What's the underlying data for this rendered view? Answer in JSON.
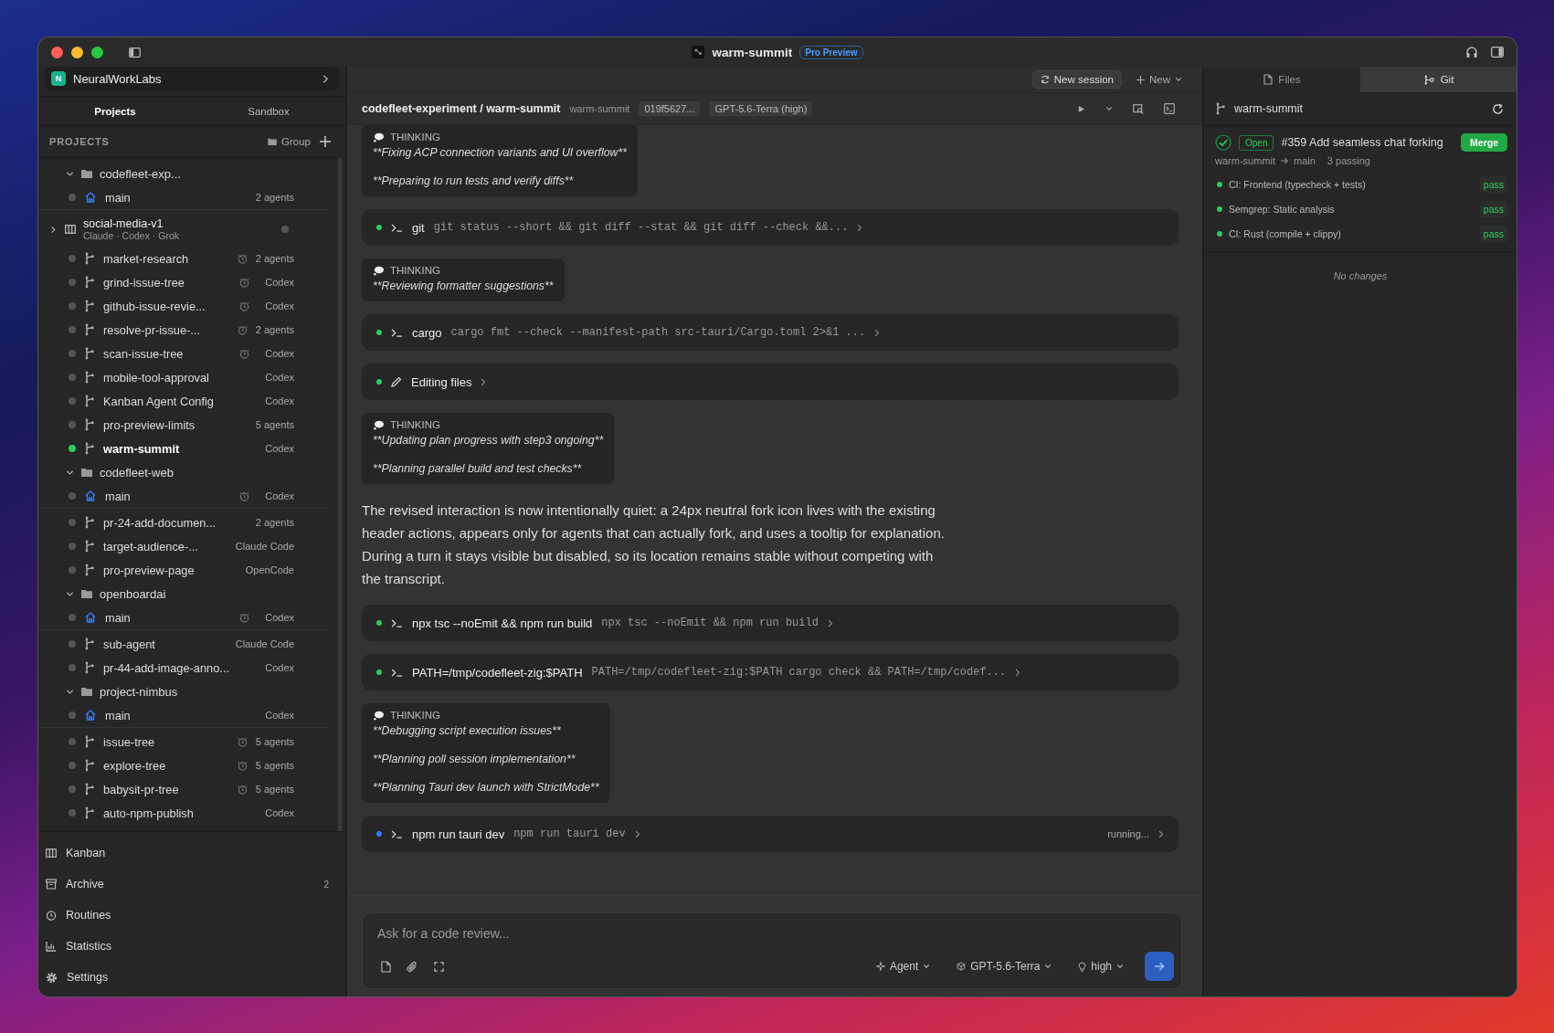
{
  "window": {
    "title": "warm-summit",
    "badge": "Pro Preview"
  },
  "workspace": {
    "initial": "N",
    "name": "NeuralWorkLabs"
  },
  "sidebar_tabs": [
    {
      "label": "Projects",
      "selected": true
    },
    {
      "label": "Sandbox",
      "selected": false
    }
  ],
  "projects_header": {
    "label": "PROJECTS",
    "group_button": "Group"
  },
  "projects": [
    {
      "name": "codefleet-exp...",
      "expanded": true,
      "children": [
        {
          "kind": "main",
          "name": "main",
          "meta": "2 agents",
          "scheduled": false,
          "active": false
        },
        {
          "kind": "board",
          "name": "social-media-v1",
          "subtitle": "Claude · Codex · Grok",
          "expanded": false,
          "active": false
        },
        {
          "kind": "branch",
          "name": "market-research",
          "meta": "2 agents",
          "scheduled": true,
          "active": false
        },
        {
          "kind": "branch",
          "name": "grind-issue-tree",
          "meta": "Codex",
          "scheduled": true,
          "active": false
        },
        {
          "kind": "branch",
          "name": "github-issue-revie...",
          "meta": "Codex",
          "scheduled": true,
          "active": false
        },
        {
          "kind": "branch",
          "name": "resolve-pr-issue-...",
          "meta": "2 agents",
          "scheduled": true,
          "active": false
        },
        {
          "kind": "branch",
          "name": "scan-issue-tree",
          "meta": "Codex",
          "scheduled": true,
          "active": false
        },
        {
          "kind": "branch",
          "name": "mobile-tool-approval",
          "meta": "Codex",
          "scheduled": false,
          "active": false
        },
        {
          "kind": "branch",
          "name": "Kanban Agent Config",
          "meta": "Codex",
          "scheduled": false,
          "active": false
        },
        {
          "kind": "branch",
          "name": "pro-preview-limits",
          "meta": "5 agents",
          "scheduled": false,
          "active": false
        },
        {
          "kind": "branch",
          "name": "warm-summit",
          "meta": "Codex",
          "scheduled": false,
          "active": true
        }
      ]
    },
    {
      "name": "codefleet-web",
      "expanded": true,
      "children": [
        {
          "kind": "main",
          "name": "main",
          "meta": "Codex",
          "scheduled": true,
          "active": false
        },
        {
          "kind": "branch",
          "name": "pr-24-add-documen...",
          "meta": "2 agents",
          "scheduled": false,
          "active": false
        },
        {
          "kind": "branch",
          "name": "target-audience-...",
          "meta": "Claude Code",
          "scheduled": false,
          "active": false
        },
        {
          "kind": "branch",
          "name": "pro-preview-page",
          "meta": "OpenCode",
          "scheduled": false,
          "active": false
        }
      ]
    },
    {
      "name": "openboardai",
      "expanded": true,
      "children": [
        {
          "kind": "main",
          "name": "main",
          "meta": "Codex",
          "scheduled": true,
          "active": false
        },
        {
          "kind": "branch",
          "name": "sub-agent",
          "meta": "Claude Code",
          "scheduled": false,
          "active": false
        },
        {
          "kind": "branch",
          "name": "pr-44-add-image-anno...",
          "meta": "Codex",
          "scheduled": false,
          "active": false
        }
      ]
    },
    {
      "name": "project-nimbus",
      "expanded": true,
      "children": [
        {
          "kind": "main",
          "name": "main",
          "meta": "Codex",
          "scheduled": false,
          "active": false
        },
        {
          "kind": "branch",
          "name": "issue-tree",
          "meta": "5 agents",
          "scheduled": true,
          "active": false
        },
        {
          "kind": "branch",
          "name": "explore-tree",
          "meta": "5 agents",
          "scheduled": true,
          "active": false
        },
        {
          "kind": "branch",
          "name": "babysit-pr-tree",
          "meta": "5 agents",
          "scheduled": true,
          "active": false
        },
        {
          "kind": "branch",
          "name": "auto-npm-publish",
          "meta": "Codex",
          "scheduled": false,
          "active": false
        }
      ]
    }
  ],
  "nav": [
    {
      "kind": "kanban",
      "label": "Kanban"
    },
    {
      "kind": "archive",
      "label": "Archive",
      "count": "2"
    },
    {
      "kind": "routines",
      "label": "Routines"
    },
    {
      "kind": "statistics",
      "label": "Statistics"
    },
    {
      "kind": "settings",
      "label": "Settings"
    }
  ],
  "toolbar": {
    "new_session": "New session",
    "new": "New"
  },
  "session_header": {
    "path": "codefleet-experiment / warm-summit",
    "branch": "warm-summit",
    "session_id": "019f5627...",
    "model": "GPT-5.6-Terra (high)"
  },
  "transcript": [
    {
      "kind": "thinking",
      "label": "THINKING",
      "lines": [
        "**Fixing ACP connection variants and UI overflow**",
        "**Preparing to run tests and verify diffs**"
      ]
    },
    {
      "kind": "command",
      "running": false,
      "name": "git",
      "detail": "git status --short && git diff --stat && git diff --check &&..."
    },
    {
      "kind": "thinking",
      "label": "THINKING",
      "lines": [
        "**Reviewing formatter suggestions**"
      ]
    },
    {
      "kind": "command",
      "running": false,
      "name": "cargo",
      "detail": "cargo fmt --check --manifest-path src-tauri/Cargo.toml 2>&1 ..."
    },
    {
      "kind": "edit",
      "running": false,
      "name": "Editing files"
    },
    {
      "kind": "thinking",
      "label": "THINKING",
      "lines": [
        "**Updating plan progress with step3 ongoing**",
        "**Planning parallel build and test checks**"
      ]
    },
    {
      "kind": "message",
      "text": "The revised interaction is now intentionally quiet: a 24px neutral fork icon lives with the existing header actions, appears only for agents that can actually fork, and uses a tooltip for explanation. During a turn it stays visible but disabled, so its location remains stable without competing with the transcript."
    },
    {
      "kind": "command",
      "running": false,
      "name": "npx tsc --noEmit && npm run build",
      "detail": "npx tsc --noEmit && npm run build"
    },
    {
      "kind": "command",
      "running": false,
      "name": "PATH=/tmp/codefleet-zig:$PATH",
      "detail": "PATH=/tmp/codefleet-zig:$PATH cargo check && PATH=/tmp/codef..."
    },
    {
      "kind": "thinking",
      "label": "THINKING",
      "lines": [
        "**Debugging script execution issues**",
        "**Planning poll session implementation**",
        "**Planning Tauri dev launch with StrictMode**"
      ]
    },
    {
      "kind": "command",
      "running": true,
      "name": "npm run tauri dev",
      "detail": "npm run tauri dev",
      "trailing": "running..."
    }
  ],
  "composer": {
    "placeholder": "Ask for a code review...",
    "mode": "Agent",
    "model": "GPT-5.6-Terra",
    "effort": "high"
  },
  "panel_tabs": [
    {
      "label": "Files",
      "selected": false
    },
    {
      "label": "Git",
      "selected": true
    }
  ],
  "git": {
    "branch": "warm-summit",
    "pr": {
      "status": "Open",
      "title": "#359 Add seamless chat forking",
      "merge": "Merge",
      "from": "warm-summit",
      "to": "main",
      "summary": "3 passing"
    },
    "checks": [
      {
        "name": "CI: Frontend (typecheck + tests)",
        "result": "pass"
      },
      {
        "name": "Semgrep: Static analysis",
        "result": "pass"
      },
      {
        "name": "CI: Rust (compile + clippy)",
        "result": "pass"
      }
    ],
    "empty": "No changes"
  }
}
